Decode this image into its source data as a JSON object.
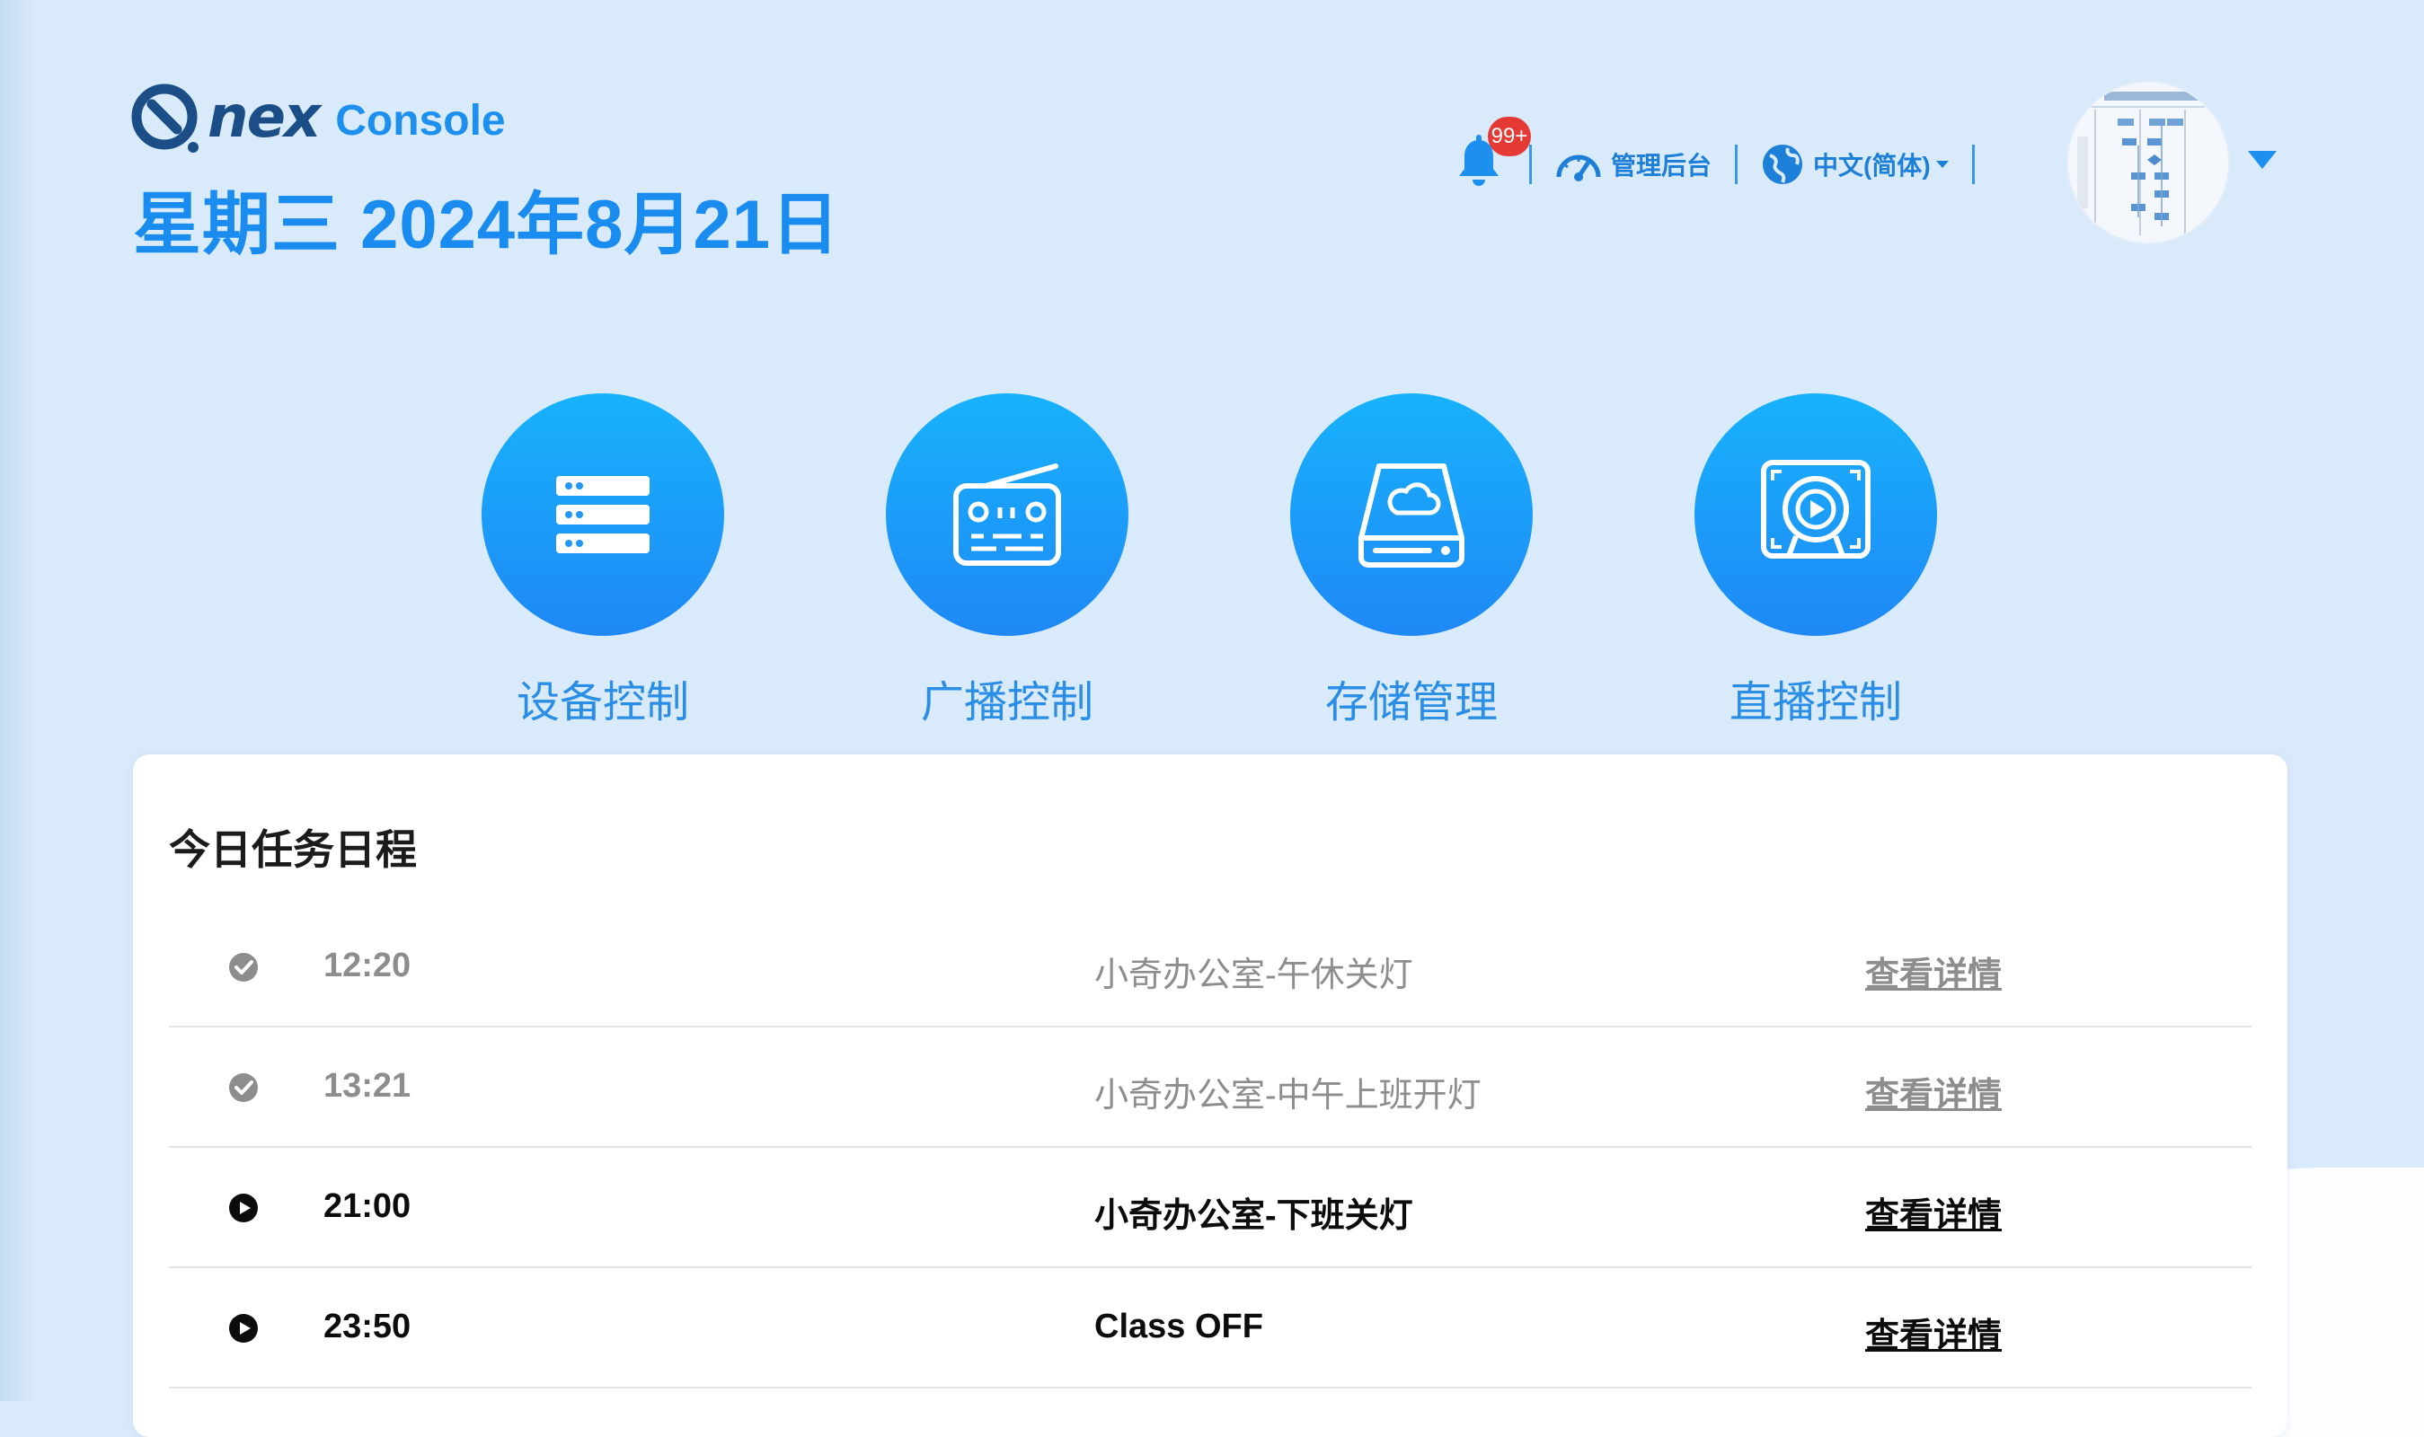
{
  "header": {
    "logo_word": "nex",
    "logo_console": "Console",
    "date": "星期三 2024年8月21日"
  },
  "toolbar": {
    "notification_badge": "99+",
    "admin_label": "管理后台",
    "language_label": "中文(简体)"
  },
  "actions": [
    {
      "label": "设备控制",
      "icon": "server-icon"
    },
    {
      "label": "广播控制",
      "icon": "radio-icon"
    },
    {
      "label": "存储管理",
      "icon": "cloud-storage-icon"
    },
    {
      "label": "直播控制",
      "icon": "live-camera-icon"
    }
  ],
  "schedule": {
    "title": "今日任务日程",
    "rows": [
      {
        "time": "12:20",
        "name": "小奇办公室-午休关灯",
        "link": "查看详情",
        "status": "done"
      },
      {
        "time": "13:21",
        "name": "小奇办公室-中午上班开灯",
        "link": "查看详情",
        "status": "done"
      },
      {
        "time": "21:00",
        "name": "小奇办公室-下班关灯",
        "link": "查看详情",
        "status": "pending"
      },
      {
        "time": "23:50",
        "name": "Class OFF",
        "link": "查看详情",
        "status": "pending"
      }
    ]
  },
  "colors": {
    "background": "#d9eafa",
    "accent": "#1a8cf0",
    "badge": "#e53935"
  }
}
